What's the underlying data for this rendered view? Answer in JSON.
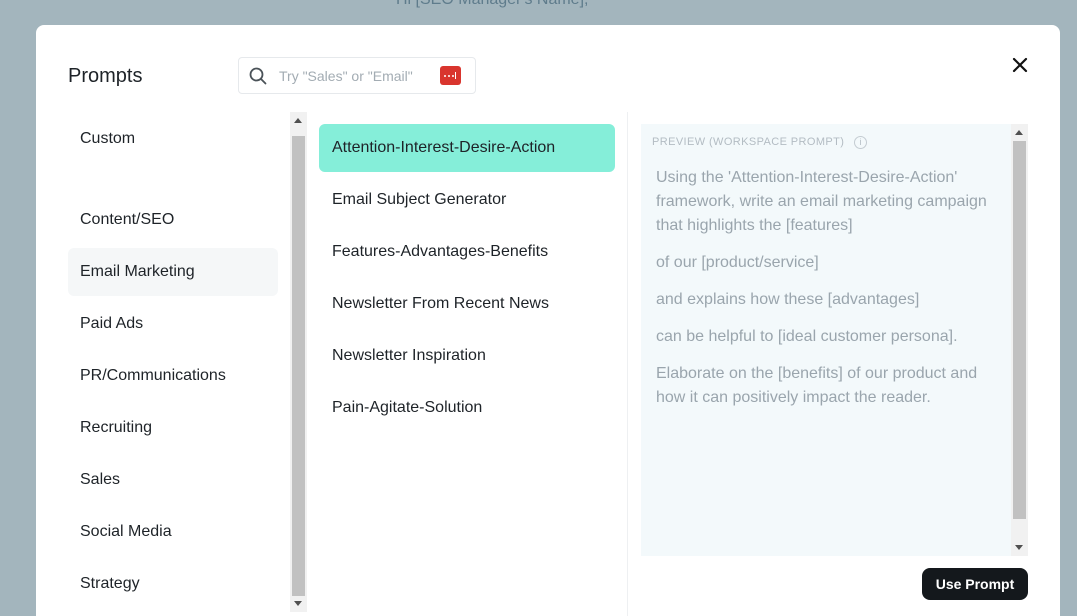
{
  "background": {
    "greeting": "Hi [SEO Manager's Name],"
  },
  "modal": {
    "title": "Prompts",
    "close_icon": "close-icon"
  },
  "search": {
    "placeholder": "Try \"Sales\" or \"Email\"",
    "icon": "search-icon",
    "extension_icon": "password-manager-icon"
  },
  "categories": [
    "Custom",
    "Content/SEO",
    "Email Marketing",
    "Paid Ads",
    "PR/Communications",
    "Recruiting",
    "Sales",
    "Social Media",
    "Strategy"
  ],
  "selected_category": "Email Marketing",
  "prompts": [
    "Attention-Interest-Desire-Action",
    "Email Subject Generator",
    "Features-Advantages-Benefits",
    "Newsletter From Recent News",
    "Newsletter Inspiration",
    "Pain-Agitate-Solution"
  ],
  "selected_prompt": "Attention-Interest-Desire-Action",
  "preview": {
    "label": "PREVIEW (WORKSPACE PROMPT)",
    "info_icon": "info-icon",
    "paragraphs": [
      "Using the 'Attention-Interest-Desire-Action' framework, write an email marketing campaign that highlights the [features]",
      "of our [product/service]",
      "and explains how these [advantages]",
      "can be helpful to [ideal customer persona].",
      "Elaborate on the [benefits] of our product and how it can positively impact the reader."
    ]
  },
  "actions": {
    "use_prompt": "Use Prompt"
  },
  "colors": {
    "selected_prompt_bg": "#85eed9",
    "selected_category_bg": "#f5f7f8",
    "button_bg": "#14181c",
    "extension_badge": "#d9352e"
  }
}
